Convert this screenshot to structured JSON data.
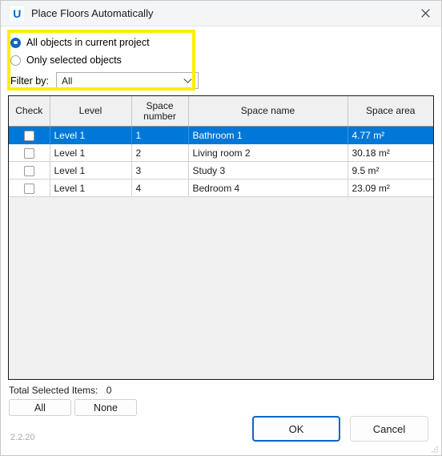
{
  "window": {
    "title": "Place Floors Automatically",
    "app_icon": "U",
    "close_icon": "close-icon",
    "version": "2.2.20"
  },
  "options": {
    "radio_all_label": "All objects in current project",
    "radio_selected_label": "Only selected objects",
    "selected": "all",
    "filter_label": "Filter by:",
    "filter_value": "All",
    "filter_options": [
      "All"
    ],
    "highlight_color": "#ffee00"
  },
  "table": {
    "columns": [
      {
        "key": "check",
        "label": "Check"
      },
      {
        "key": "level",
        "label": "Level"
      },
      {
        "key": "number",
        "label": "Space\nnumber"
      },
      {
        "key": "name",
        "label": "Space name"
      },
      {
        "key": "area",
        "label": "Space area"
      }
    ],
    "column_labels": {
      "check": "Check",
      "level": "Level",
      "number_line1": "Space",
      "number_line2": "number",
      "name": "Space name",
      "area": "Space area"
    },
    "rows": [
      {
        "checked": false,
        "level": "Level 1",
        "number": "1",
        "name": "Bathroom 1",
        "area": "4.77 m²",
        "selected": true
      },
      {
        "checked": false,
        "level": "Level 1",
        "number": "2",
        "name": "Living room 2",
        "area": "30.18 m²",
        "selected": false
      },
      {
        "checked": false,
        "level": "Level 1",
        "number": "3",
        "name": "Study 3",
        "area": "9.5 m²",
        "selected": false
      },
      {
        "checked": false,
        "level": "Level 1",
        "number": "4",
        "name": "Bedroom 4",
        "area": "23.09 m²",
        "selected": false
      }
    ],
    "selection_color": "#0078d7"
  },
  "footer": {
    "total_label": "Total Selected Items:",
    "total_count": "0",
    "all_button": "All",
    "none_button": "None",
    "ok_button": "OK",
    "cancel_button": "Cancel"
  }
}
